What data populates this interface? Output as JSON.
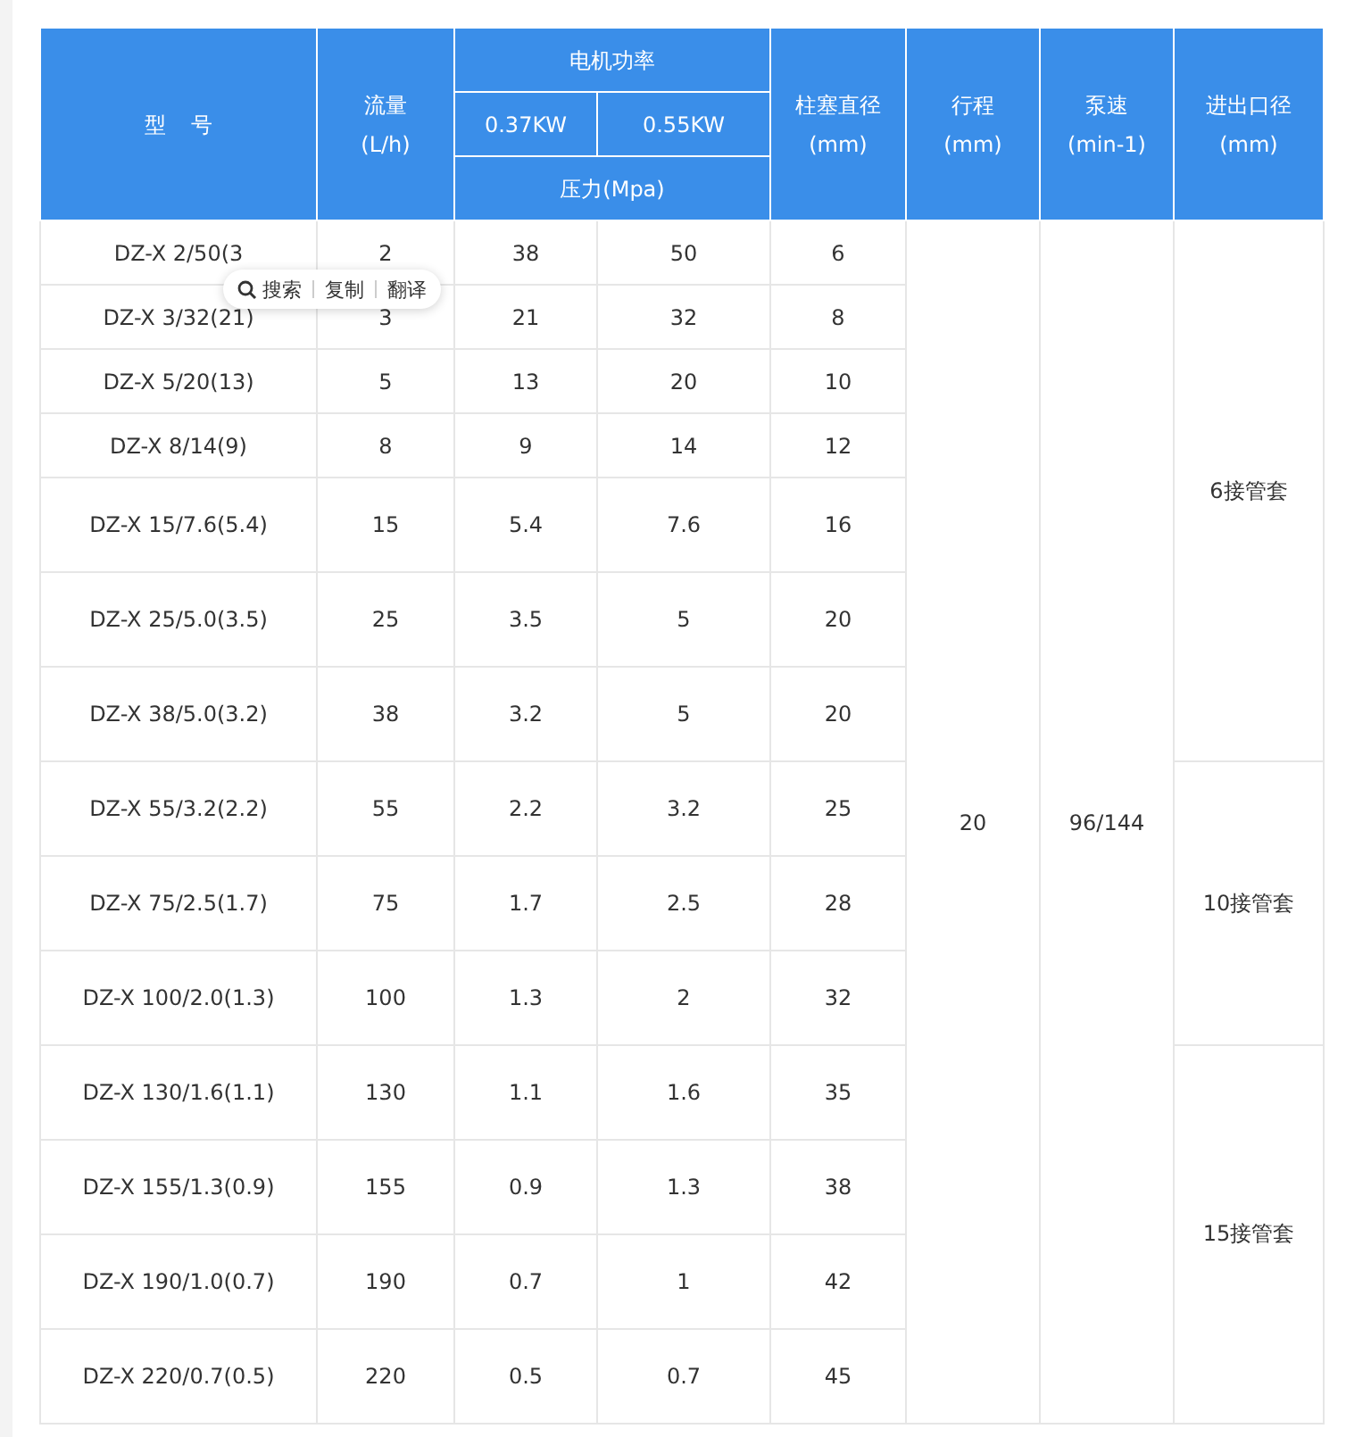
{
  "header": {
    "model": "型 号",
    "flow": [
      "流量",
      "(L/h)"
    ],
    "motor_power": "电机功率",
    "power_columns": [
      "0.37KW",
      "0.55KW"
    ],
    "pressure": "压力(Mpa)",
    "plunger": [
      "柱塞直径",
      "(mm)"
    ],
    "stroke": [
      "行程",
      "(mm)"
    ],
    "speed": [
      "泵速",
      "(min-1)"
    ],
    "port": [
      "进出口径",
      "(mm)"
    ]
  },
  "stroke": "20",
  "speed": "96/144",
  "port_groups": [
    {
      "port": "6接管套",
      "rows": [
        {
          "model": "DZ-X 2/50(3",
          "flow": "2",
          "p037": "38",
          "p055": "50",
          "plunger": "6"
        },
        {
          "model": "DZ-X 3/32(21)",
          "flow": "3",
          "p037": "21",
          "p055": "32",
          "plunger": "8"
        },
        {
          "model": "DZ-X 5/20(13)",
          "flow": "5",
          "p037": "13",
          "p055": "20",
          "plunger": "10"
        },
        {
          "model": "DZ-X 8/14(9)",
          "flow": "8",
          "p037": "9",
          "p055": "14",
          "plunger": "12"
        },
        {
          "model": "DZ-X 15/7.6(5.4)",
          "flow": "15",
          "p037": "5.4",
          "p055": "7.6",
          "plunger": "16"
        },
        {
          "model": "DZ-X 25/5.0(3.5)",
          "flow": "25",
          "p037": "3.5",
          "p055": "5",
          "plunger": "20"
        },
        {
          "model": "DZ-X 38/5.0(3.2)",
          "flow": "38",
          "p037": "3.2",
          "p055": "5",
          "plunger": "20"
        }
      ]
    },
    {
      "port": "10接管套",
      "rows": [
        {
          "model": "DZ-X 55/3.2(2.2)",
          "flow": "55",
          "p037": "2.2",
          "p055": "3.2",
          "plunger": "25"
        },
        {
          "model": "DZ-X 75/2.5(1.7)",
          "flow": "75",
          "p037": "1.7",
          "p055": "2.5",
          "plunger": "28"
        },
        {
          "model": "DZ-X 100/2.0(1.3)",
          "flow": "100",
          "p037": "1.3",
          "p055": "2",
          "plunger": "32"
        }
      ]
    },
    {
      "port": "15接管套",
      "rows": [
        {
          "model": "DZ-X 130/1.6(1.1)",
          "flow": "130",
          "p037": "1.1",
          "p055": "1.6",
          "plunger": "35"
        },
        {
          "model": "DZ-X 155/1.3(0.9)",
          "flow": "155",
          "p037": "0.9",
          "p055": "1.3",
          "plunger": "38"
        },
        {
          "model": "DZ-X 190/1.0(0.7)",
          "flow": "190",
          "p037": "0.7",
          "p055": "1",
          "plunger": "42"
        },
        {
          "model": "DZ-X 220/0.7(0.5)",
          "flow": "220",
          "p037": "0.5",
          "p055": "0.7",
          "plunger": "45"
        }
      ]
    }
  ],
  "popup": {
    "actions": [
      "搜索",
      "复制",
      "翻译"
    ]
  }
}
